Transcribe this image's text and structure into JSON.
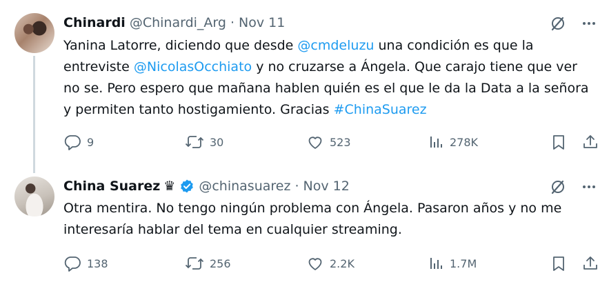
{
  "tweets": [
    {
      "author_name": "Chinardi",
      "handle": "@Chinardi_Arg",
      "separator": "·",
      "date": "Nov 11",
      "text_parts": [
        "Yanina Latorre, diciendo que desde ",
        "@cmdeluzu",
        " una condición es que la entreviste ",
        "@NicolasOcchiato",
        " y no cruzarse a Ángela. Que carajo tiene que ver no se. Pero espero que mañana hablen quién es el que le da la Data a la señora y permiten tanto hostigamiento. Gracias ",
        "#ChinaSuarez"
      ],
      "replies": "9",
      "retweets": "30",
      "likes": "523",
      "views": "278K"
    },
    {
      "author_name": "China Suarez",
      "crown": "♛",
      "verified": true,
      "handle": "@chinasuarez",
      "separator": "·",
      "date": "Nov 12",
      "text": "Otra mentira. No tengo ningún problema con Ángela. Pasaron años y no me interesaría hablar del tema en cualquier streaming.",
      "replies": "138",
      "retweets": "256",
      "likes": "2.2K",
      "views": "1.7M"
    }
  ],
  "colors": {
    "text": "#0f1419",
    "secondary": "#536471",
    "link": "#1d9bf0",
    "thread_line": "#cfd9de"
  },
  "icons": [
    "grok-icon",
    "more-icon",
    "reply-icon",
    "retweet-icon",
    "like-icon",
    "views-icon",
    "bookmark-icon",
    "share-icon",
    "verified-badge-icon"
  ]
}
